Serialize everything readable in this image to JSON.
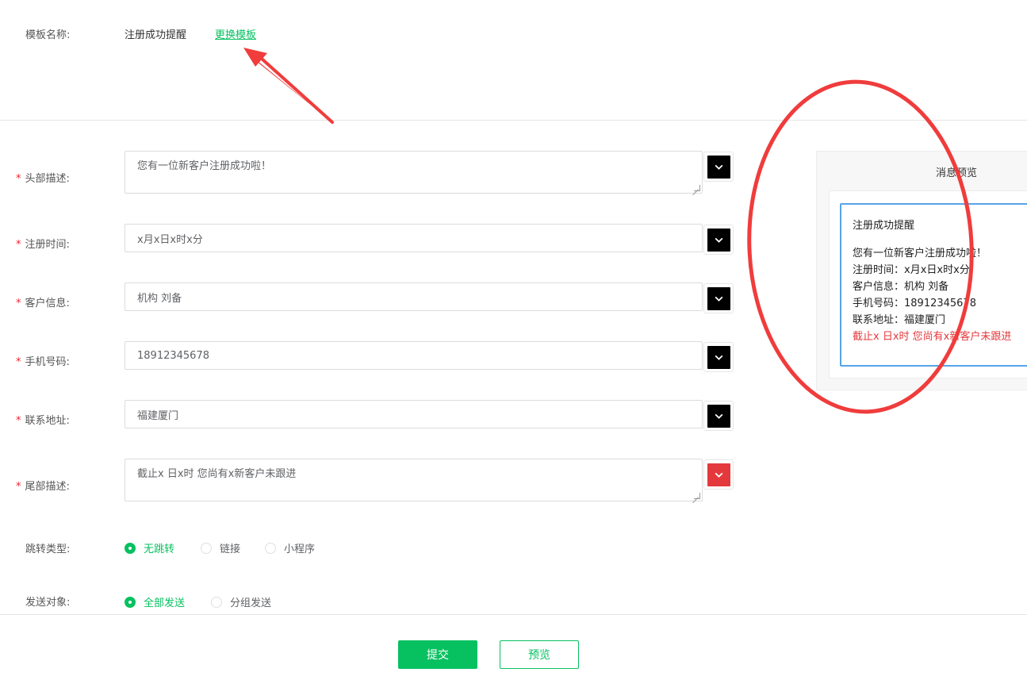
{
  "template": {
    "label": "模板名称:",
    "name": "注册成功提醒",
    "change_link": "更换模板"
  },
  "form": {
    "rows": [
      {
        "label": "头部描述:",
        "required": true,
        "value": "您有一位新客户注册成功啦！",
        "type": "textarea",
        "color": "#000000"
      },
      {
        "label": "注册时间:",
        "required": true,
        "value": "x月x日x时x分",
        "type": "input",
        "color": "#000000"
      },
      {
        "label": "客户信息:",
        "required": true,
        "value": "机构 刘备",
        "type": "input",
        "color": "#000000"
      },
      {
        "label": "手机号码:",
        "required": true,
        "value": "18912345678",
        "type": "input",
        "color": "#000000"
      },
      {
        "label": "联系地址:",
        "required": true,
        "value": "福建厦门",
        "type": "input",
        "color": "#000000"
      },
      {
        "label": "尾部描述:",
        "required": true,
        "value": "截止x 日x时 您尚有x新客户未跟进",
        "type": "textarea",
        "color": "#e4393c"
      }
    ],
    "jump_type": {
      "label": "跳转类型:",
      "options": [
        "无跳转",
        "链接",
        "小程序"
      ],
      "selected": "无跳转"
    },
    "send_target": {
      "label": "发送对象:",
      "options": [
        "全部发送",
        "分组发送"
      ],
      "selected": "全部发送"
    }
  },
  "buttons": {
    "submit": "提交",
    "preview": "预览"
  },
  "preview": {
    "title": "消息预览",
    "card_title": "注册成功提醒",
    "lines": [
      {
        "text": "您有一位新客户注册成功啦！",
        "highlight": false
      },
      {
        "text": "注册时间：x月x日x时x分",
        "highlight": false
      },
      {
        "text": "客户信息：机构 刘备",
        "highlight": false
      },
      {
        "text": "手机号码：18912345678",
        "highlight": false
      },
      {
        "text": "联系地址：福建厦门",
        "highlight": false
      },
      {
        "text": "截止x 日x时 您尚有x新客户未跟进",
        "highlight": true
      }
    ]
  },
  "colors": {
    "accent": "#07c160",
    "required_star": "#f5222d",
    "annotation": "#f03c3c",
    "preview_border": "#56a4e8"
  },
  "icons": {
    "color_picker": "chevron-down-icon",
    "radio": "radio-icon"
  }
}
